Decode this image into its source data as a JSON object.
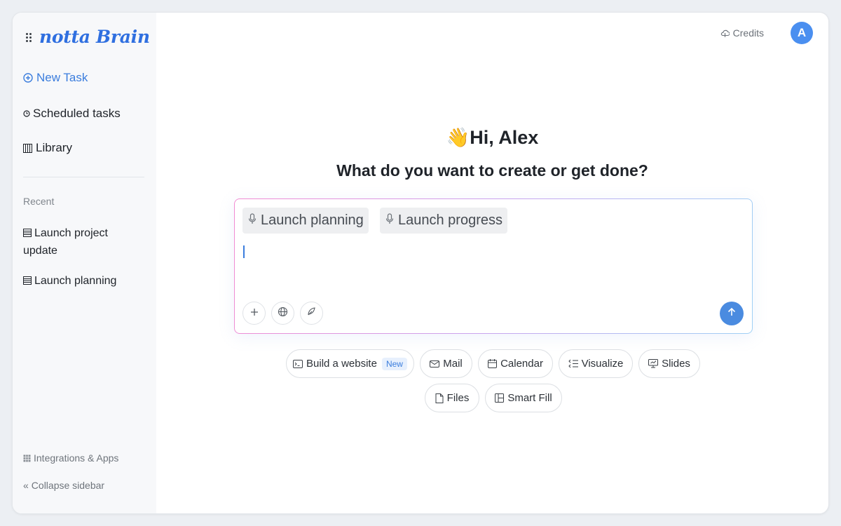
{
  "app": {
    "brand": "notta Brain"
  },
  "sidebar": {
    "new_task": "New Task",
    "scheduled": "Scheduled tasks",
    "library": "Library",
    "recent_label": "Recent",
    "recent": [
      {
        "label": "Launch project update"
      },
      {
        "label": "Launch planning"
      }
    ],
    "integrations": "Integrations & Apps",
    "collapse": "Collapse sidebar"
  },
  "header": {
    "credits": "Credits",
    "avatar_initial": "A"
  },
  "main": {
    "greeting_emoji": "👋",
    "greeting": "Hi, Alex",
    "subtitle": "What do you want to create or get done?"
  },
  "composer": {
    "chips": [
      {
        "label": "Launch planning",
        "icon": "mic-icon"
      },
      {
        "label": "Launch progress",
        "icon": "mic-icon"
      }
    ],
    "value": ""
  },
  "quick_actions": [
    {
      "label": "Build a website",
      "icon": "terminal-icon",
      "badge": "New"
    },
    {
      "label": "Mail",
      "icon": "mail-icon"
    },
    {
      "label": "Calendar",
      "icon": "calendar-icon"
    },
    {
      "label": "Visualize",
      "icon": "visualize-icon"
    },
    {
      "label": "Slides",
      "icon": "slides-icon"
    },
    {
      "label": "Files",
      "icon": "file-icon"
    },
    {
      "label": "Smart Fill",
      "icon": "table-icon"
    }
  ],
  "colors": {
    "accent": "#3b7ddd",
    "avatar": "#4a8ff0",
    "send_button": "#4a8be0",
    "sidebar_bg": "#f7f8fa"
  }
}
